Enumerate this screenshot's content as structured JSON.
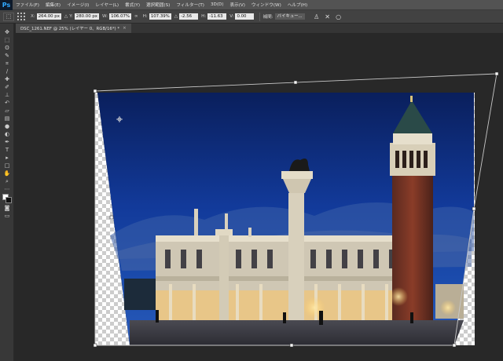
{
  "app": {
    "logo": "Ps"
  },
  "menu": [
    "ファイル(F)",
    "編集(E)",
    "イメージ(I)",
    "レイヤー(L)",
    "書式(Y)",
    "選択範囲(S)",
    "フィルター(T)",
    "3D(D)",
    "表示(V)",
    "ウィンドウ(W)",
    "ヘルプ(H)"
  ],
  "options": {
    "x_label": "X:",
    "x": "264.00 px",
    "y_label": "Y:",
    "y": "280.00 px",
    "w_label": "W:",
    "w": "106.07%",
    "h_label": "H:",
    "h": "107.39%",
    "angle_label": "△",
    "angle": "-2.56",
    "hskew_label": "H:",
    "hskew": "-11.63",
    "vskew_label": "V:",
    "vskew": "0.00",
    "interp_label": "補間:",
    "interp": "バイキュー...",
    "confirm_icon": "check-icon",
    "cancel_icon": "cancel-icon"
  },
  "document": {
    "tab_title": "DSC_1261.NEF @ 25% (レイヤー 0、RGB/16*) *",
    "close": "×"
  },
  "tools": [
    "move",
    "marquee",
    "lasso",
    "quick-select",
    "crop",
    "eyedropper",
    "healing",
    "brush",
    "clone-stamp",
    "history-brush",
    "eraser",
    "gradient",
    "blur",
    "dodge",
    "pen",
    "type",
    "path-select",
    "rectangle",
    "hand",
    "zoom"
  ]
}
